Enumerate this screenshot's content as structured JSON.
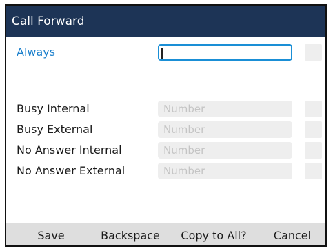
{
  "header": {
    "title": "Call Forward"
  },
  "rows": [
    {
      "label": "Always",
      "value": "",
      "placeholder": "",
      "focused": true
    },
    {
      "label": "Busy Internal",
      "value": "",
      "placeholder": "Number"
    },
    {
      "label": "Busy External",
      "value": "",
      "placeholder": "Number"
    },
    {
      "label": "No Answer Internal",
      "value": "",
      "placeholder": "Number"
    },
    {
      "label": "No Answer External",
      "value": "",
      "placeholder": "Number"
    }
  ],
  "softkeys": {
    "save": "Save",
    "backspace": "Backspace",
    "copy_to_all": "Copy to All?",
    "cancel": "Cancel"
  },
  "colors": {
    "title_bar": "#1d3456",
    "accent": "#1a7fcc",
    "focus_border": "#1a8fd6",
    "softkey_bar": "#dedede",
    "field_bg": "#eeeeee",
    "placeholder_text": "#c4c4c4"
  }
}
